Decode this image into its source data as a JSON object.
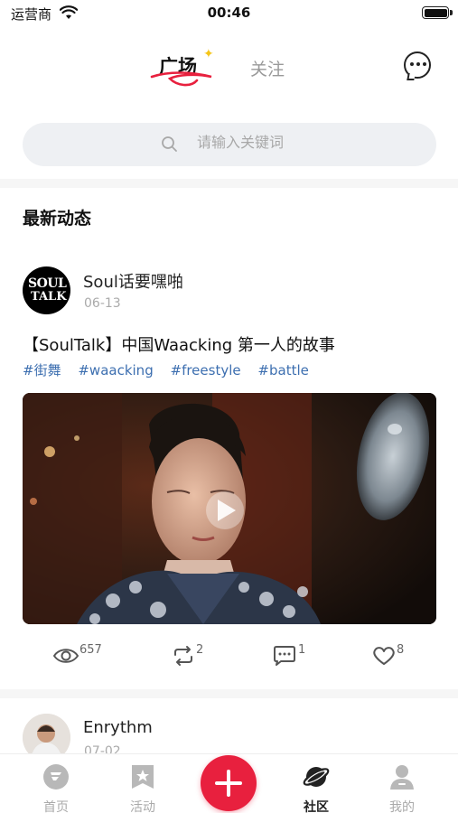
{
  "status_bar": {
    "carrier": "运营商",
    "time": "00:46"
  },
  "header": {
    "tabs": [
      {
        "label": "广场",
        "active": true
      },
      {
        "label": "关注",
        "active": false
      }
    ]
  },
  "search": {
    "placeholder": "请输入关键词"
  },
  "section": {
    "title": "最新动态"
  },
  "posts": [
    {
      "user": "Soul话要嘿啪",
      "avatar_text": [
        "SOUL",
        "TALK"
      ],
      "date": "06-13",
      "title": "【SoulTalk】中国Waacking 第一人的故事",
      "tags": [
        "#街舞",
        "#waacking",
        "#freestyle",
        "#battle"
      ],
      "stats": {
        "views": "657",
        "reposts": "2",
        "comments": "1",
        "likes": "8"
      }
    },
    {
      "user": "Enrythm",
      "date": "07-02"
    }
  ],
  "tabbar": {
    "items": [
      {
        "label": "首页",
        "icon": "home-icon",
        "active": false
      },
      {
        "label": "活动",
        "icon": "activity-icon",
        "active": false
      },
      {
        "label": "社区",
        "icon": "planet-icon",
        "active": true
      },
      {
        "label": "我的",
        "icon": "profile-icon",
        "active": false
      }
    ]
  },
  "colors": {
    "accent": "#e8203e",
    "tag": "#3d6fb0",
    "muted": "#aaaaaa"
  }
}
